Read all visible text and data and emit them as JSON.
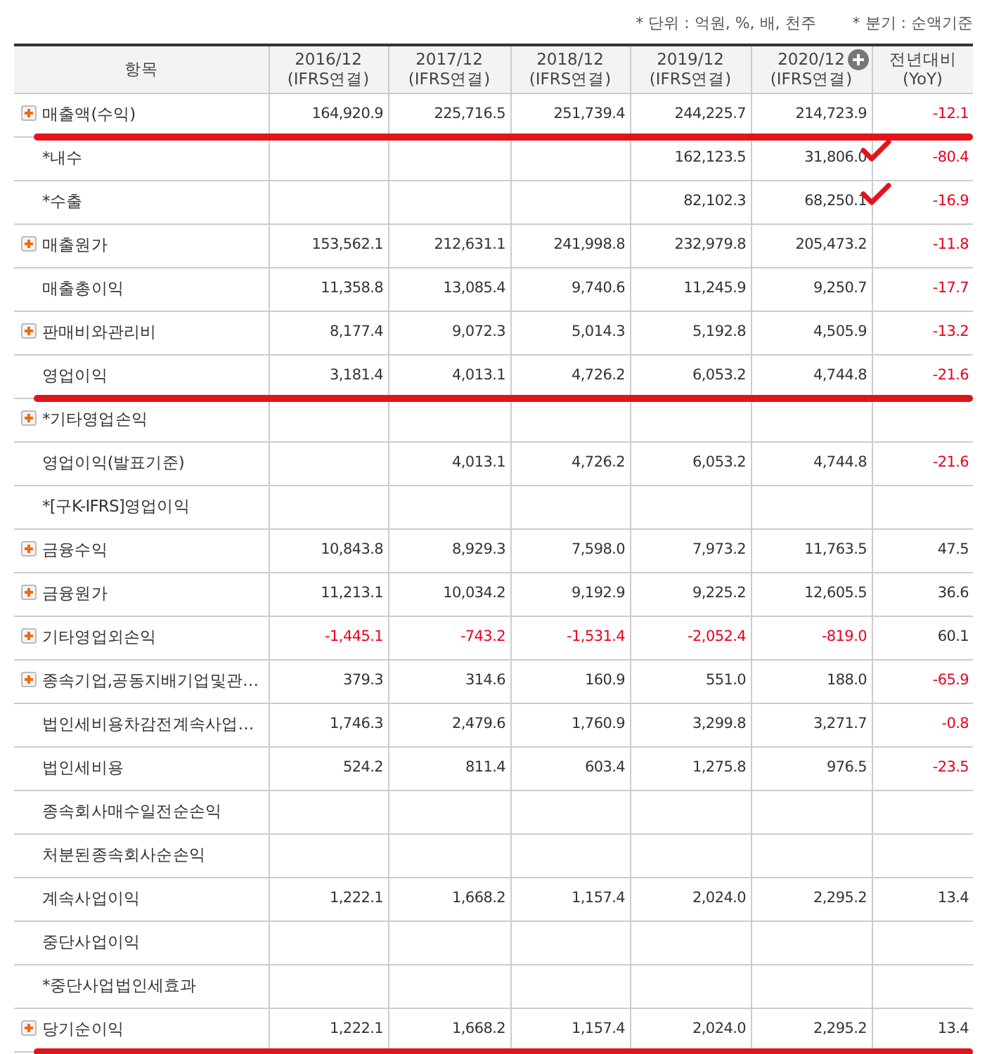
{
  "notes": [
    "* 단위 : 억원, %, 배, 천주",
    "* 분기 : 순액기준"
  ],
  "header": {
    "item": "항목",
    "periods": [
      {
        "period": "2016/12",
        "basis": "(IFRS연결)",
        "expandable": false
      },
      {
        "period": "2017/12",
        "basis": "(IFRS연결)",
        "expandable": false
      },
      {
        "period": "2018/12",
        "basis": "(IFRS연결)",
        "expandable": false
      },
      {
        "period": "2019/12",
        "basis": "(IFRS연결)",
        "expandable": false
      },
      {
        "period": "2020/12",
        "basis": "(IFRS연결)",
        "expandable": true
      }
    ],
    "change": "전년대비",
    "change_sub": "(YoY)"
  },
  "rows": [
    {
      "label": "매출액(수익)",
      "expandable": true,
      "values": {
        "y2016": "164,920.9",
        "y2017": "225,716.5",
        "y2018": "251,739.4",
        "y2019": "244,225.7",
        "y2020": "214,723.9"
      },
      "values_negative": false,
      "yoy": "-12.1",
      "yoy_negative": true,
      "underlined": true,
      "checked": false
    },
    {
      "label": "*내수",
      "expandable": false,
      "values": {
        "y2019": "162,123.5",
        "y2020": "31,806.0"
      },
      "values_negative": false,
      "yoy": "-80.4",
      "yoy_negative": true,
      "underlined": false,
      "checked": true
    },
    {
      "label": "*수출",
      "expandable": false,
      "values": {
        "y2019": "82,102.3",
        "y2020": "68,250.1"
      },
      "values_negative": false,
      "yoy": "-16.9",
      "yoy_negative": true,
      "underlined": false,
      "checked": true
    },
    {
      "label": "매출원가",
      "expandable": true,
      "values": {
        "y2016": "153,562.1",
        "y2017": "212,631.1",
        "y2018": "241,998.8",
        "y2019": "232,979.8",
        "y2020": "205,473.2"
      },
      "values_negative": false,
      "yoy": "-11.8",
      "yoy_negative": true,
      "underlined": false,
      "checked": false
    },
    {
      "label": "매출총이익",
      "expandable": false,
      "values": {
        "y2016": "11,358.8",
        "y2017": "13,085.4",
        "y2018": "9,740.6",
        "y2019": "11,245.9",
        "y2020": "9,250.7"
      },
      "values_negative": false,
      "yoy": "-17.7",
      "yoy_negative": true,
      "underlined": false,
      "checked": false
    },
    {
      "label": "판매비와관리비",
      "expandable": true,
      "values": {
        "y2016": "8,177.4",
        "y2017": "9,072.3",
        "y2018": "5,014.3",
        "y2019": "5,192.8",
        "y2020": "4,505.9"
      },
      "values_negative": false,
      "yoy": "-13.2",
      "yoy_negative": true,
      "underlined": false,
      "checked": false
    },
    {
      "label": "영업이익",
      "expandable": false,
      "values": {
        "y2016": "3,181.4",
        "y2017": "4,013.1",
        "y2018": "4,726.2",
        "y2019": "6,053.2",
        "y2020": "4,744.8"
      },
      "values_negative": false,
      "yoy": "-21.6",
      "yoy_negative": true,
      "underlined": true,
      "checked": false
    },
    {
      "label": "*기타영업손익",
      "expandable": true,
      "values": {},
      "underlined": false,
      "checked": false
    },
    {
      "label": "영업이익(발표기준)",
      "expandable": false,
      "values": {
        "y2017": "4,013.1",
        "y2018": "4,726.2",
        "y2019": "6,053.2",
        "y2020": "4,744.8"
      },
      "values_negative": false,
      "yoy": "-21.6",
      "yoy_negative": true,
      "underlined": false,
      "checked": false
    },
    {
      "label": "*[구K-IFRS]영업이익",
      "expandable": false,
      "values": {},
      "underlined": false,
      "checked": false
    },
    {
      "label": "금융수익",
      "expandable": true,
      "values": {
        "y2016": "10,843.8",
        "y2017": "8,929.3",
        "y2018": "7,598.0",
        "y2019": "7,973.2",
        "y2020": "11,763.5"
      },
      "values_negative": false,
      "yoy": "47.5",
      "yoy_negative": false,
      "underlined": false,
      "checked": false
    },
    {
      "label": "금융원가",
      "expandable": true,
      "values": {
        "y2016": "11,213.1",
        "y2017": "10,034.2",
        "y2018": "9,192.9",
        "y2019": "9,225.2",
        "y2020": "12,605.5"
      },
      "values_negative": false,
      "yoy": "36.6",
      "yoy_negative": false,
      "underlined": false,
      "checked": false
    },
    {
      "label": "기타영업외손익",
      "expandable": true,
      "values": {
        "y2016": "-1,445.1",
        "y2017": "-743.2",
        "y2018": "-1,531.4",
        "y2019": "-2,052.4",
        "y2020": "-819.0"
      },
      "values_negative": true,
      "yoy": "60.1",
      "yoy_negative": false,
      "underlined": false,
      "checked": false
    },
    {
      "label": "종속기업,공동지배기업및관…",
      "expandable": true,
      "values": {
        "y2016": "379.3",
        "y2017": "314.6",
        "y2018": "160.9",
        "y2019": "551.0",
        "y2020": "188.0"
      },
      "values_negative": false,
      "yoy": "-65.9",
      "yoy_negative": true,
      "underlined": false,
      "checked": false
    },
    {
      "label": "법인세비용차감전계속사업…",
      "expandable": false,
      "values": {
        "y2016": "1,746.3",
        "y2017": "2,479.6",
        "y2018": "1,760.9",
        "y2019": "3,299.8",
        "y2020": "3,271.7"
      },
      "values_negative": false,
      "yoy": "-0.8",
      "yoy_negative": true,
      "underlined": false,
      "checked": false
    },
    {
      "label": "법인세비용",
      "expandable": false,
      "values": {
        "y2016": "524.2",
        "y2017": "811.4",
        "y2018": "603.4",
        "y2019": "1,275.8",
        "y2020": "976.5"
      },
      "values_negative": false,
      "yoy": "-23.5",
      "yoy_negative": true,
      "underlined": false,
      "checked": false
    },
    {
      "label": "종속회사매수일전순손익",
      "expandable": false,
      "values": {},
      "underlined": false,
      "checked": false
    },
    {
      "label": "처분된종속회사순손익",
      "expandable": false,
      "values": {},
      "underlined": false,
      "checked": false
    },
    {
      "label": "계속사업이익",
      "expandable": false,
      "values": {
        "y2016": "1,222.1",
        "y2017": "1,668.2",
        "y2018": "1,157.4",
        "y2019": "2,024.0",
        "y2020": "2,295.2"
      },
      "values_negative": false,
      "yoy": "13.4",
      "yoy_negative": false,
      "underlined": false,
      "checked": false
    },
    {
      "label": "중단사업이익",
      "expandable": false,
      "values": {},
      "underlined": false,
      "checked": false
    },
    {
      "label": "*중단사업법인세효과",
      "expandable": false,
      "values": {},
      "underlined": false,
      "checked": false
    },
    {
      "label": "당기순이익",
      "expandable": true,
      "values": {
        "y2016": "1,222.1",
        "y2017": "1,668.2",
        "y2018": "1,157.4",
        "y2019": "2,024.0",
        "y2020": "2,295.2"
      },
      "values_negative": false,
      "yoy": "13.4",
      "yoy_negative": false,
      "underlined": true,
      "checked": false
    }
  ]
}
